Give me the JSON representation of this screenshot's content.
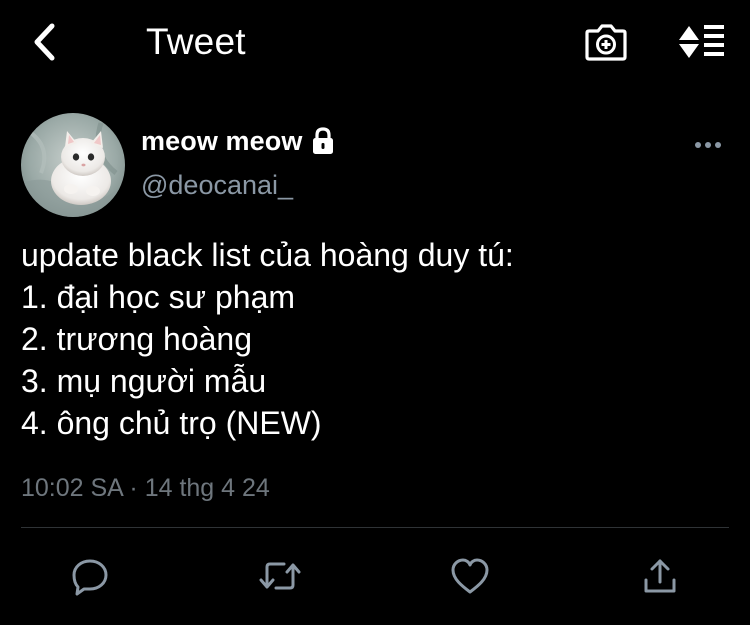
{
  "header": {
    "title": "Tweet",
    "back_icon": "chevron-left-icon",
    "camera_icon": "camera-plus-icon",
    "sort_icon": "sort-list-icon"
  },
  "tweet": {
    "author": {
      "display_name": "meow meow",
      "handle": "@deocanai_",
      "protected": true,
      "avatar": "white-kitten-photo"
    },
    "lines": [
      "update black list của hoàng duy tú:",
      "1. đại học sư phạm",
      "2. trương hoàng",
      "3. mụ người mẫu",
      "4. ông chủ trọ (NEW)"
    ],
    "timestamp": "10:02 SA · 14 thg 4 24"
  },
  "actions": [
    "reply-icon",
    "retweet-icon",
    "like-icon",
    "share-icon"
  ],
  "colors": {
    "background": "#000000",
    "text": "#ffffff",
    "secondary_text": "#8b98a5",
    "timestamp": "#6e767d",
    "divider": "#2f3336",
    "icon": "#8b98a5"
  }
}
